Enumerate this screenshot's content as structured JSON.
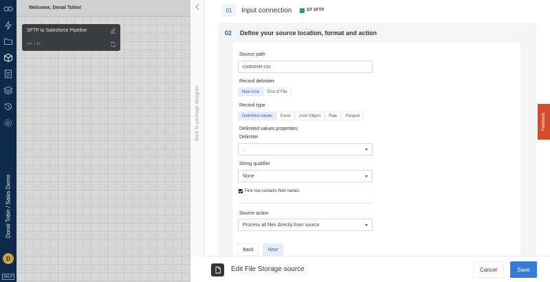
{
  "nav": {
    "icons": [
      "logo-icon",
      "lightning-icon",
      "folder-icon",
      "package-icon",
      "clipboard-icon",
      "layers-icon",
      "history-icon",
      "gear-icon"
    ],
    "user_workspace": "Donal Tobin / Sales Demo",
    "avatar_initial": "D",
    "help_label": "HELP"
  },
  "canvas": {
    "welcome": "Welcome, Donal Tobin!",
    "pipeline": {
      "name": "SFTP to Salesforce Pipeline",
      "version": "Ver. 1.15"
    }
  },
  "drawer": {
    "back_label": "Back to package designer",
    "step1": {
      "number": "01",
      "title": "Input connection",
      "connection": "DT SFTP"
    },
    "step2": {
      "number": "02",
      "title": "Define your source location, format and action"
    },
    "form": {
      "source_path_label": "Source path",
      "source_path_value": "customer.csv",
      "record_delimiter_label": "Record delimiter",
      "record_delimiter_options": [
        "New Line",
        "End of File"
      ],
      "record_delimiter_selected": "New Line",
      "record_type_label": "Record type",
      "record_type_options": [
        "Delimited values",
        "Excel",
        "Json Object",
        "Raw",
        "Parquet"
      ],
      "record_type_selected": "Delimited values",
      "delimited_props_label": "Delimited values properties:",
      "delimiter_label": "Delimiter",
      "delimiter_value": ",",
      "string_qualifier_label": "String qualifier",
      "string_qualifier_value": "None",
      "first_row_label": "First row contains field names",
      "first_row_checked": true,
      "source_action_label": "Source action",
      "source_action_value": "Process all files directly from source",
      "back_button": "Back",
      "next_button": "Next"
    },
    "feedback_label": "Feedback",
    "footer": {
      "title": "Edit File Storage source",
      "cancel_button": "Cancel",
      "save_button": "Save"
    }
  },
  "colors": {
    "nav_bg": "#0e2a4a",
    "accent": "#3a7bd5",
    "feedback": "#d34c2c",
    "connection_green": "#2e9c5a"
  }
}
